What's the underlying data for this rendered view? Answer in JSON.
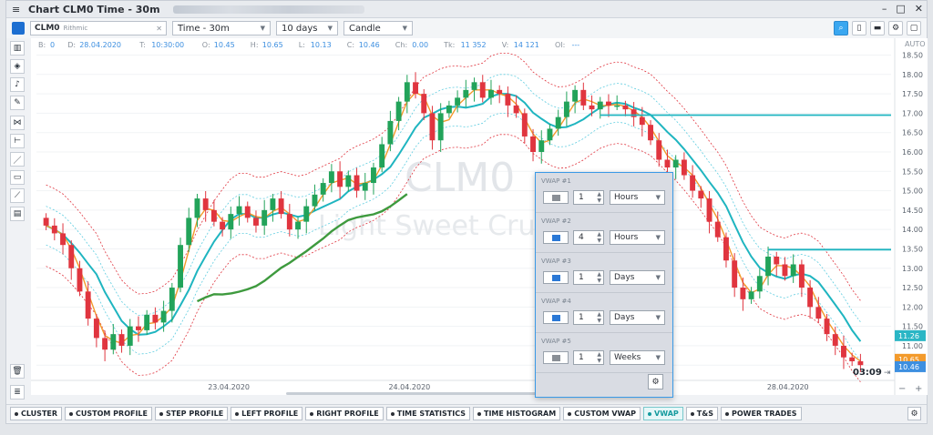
{
  "window": {
    "title": "Chart CLM0 Time - 30m"
  },
  "toolbar": {
    "symbol": "CLM0",
    "symbol_source": "Rithmic",
    "timeframe": "Time - 30m",
    "range": "10 days",
    "chart_type": "Candle"
  },
  "infobar": {
    "items": [
      {
        "k": "B:",
        "v": "0"
      },
      {
        "k": "D:",
        "v": "28.04.2020"
      },
      {
        "k": "T:",
        "v": "10:30:00"
      },
      {
        "k": "O:",
        "v": "10.45"
      },
      {
        "k": "H:",
        "v": "10.65"
      },
      {
        "k": "L:",
        "v": "10.13"
      },
      {
        "k": "C:",
        "v": "10.46"
      },
      {
        "k": "Ch:",
        "v": "0.00"
      },
      {
        "k": "Tk:",
        "v": "11 352"
      },
      {
        "k": "V:",
        "v": "14 121"
      },
      {
        "k": "OI:",
        "v": "---"
      }
    ]
  },
  "watermark": {
    "symbol": "CLM0",
    "name": "Light Sweet Cru"
  },
  "price_axis": {
    "auto_label": "AUTO",
    "ticks": [
      "18.50",
      "18.00",
      "17.50",
      "17.00",
      "16.50",
      "16.00",
      "15.50",
      "15.00",
      "14.50",
      "14.00",
      "13.50",
      "13.00",
      "12.50",
      "12.00",
      "11.50",
      "11.00",
      "10.50"
    ],
    "tags": [
      {
        "label": "11.26",
        "price": 11.26,
        "color": "#2bb6c5"
      },
      {
        "label": "10.65",
        "price": 10.65,
        "color": "#f39a2b"
      },
      {
        "label": "10.46",
        "price": 10.46,
        "color": "#3d8fe0"
      }
    ]
  },
  "time_axis": {
    "labels": [
      {
        "text": "23.04.2020",
        "pos": 0.23
      },
      {
        "text": "24.04.2020",
        "pos": 0.44
      },
      {
        "text": "28.04.2020",
        "pos": 0.88
      }
    ],
    "countdown": "03:09"
  },
  "vwap_popup": {
    "rows": [
      {
        "label": "VWAP #1",
        "color": "#8a8f96",
        "period": "1",
        "unit": "Hours"
      },
      {
        "label": "VWAP #2",
        "color": "#2a78d6",
        "period": "4",
        "unit": "Hours"
      },
      {
        "label": "VWAP #3",
        "color": "#2a78d6",
        "period": "1",
        "unit": "Days"
      },
      {
        "label": "VWAP #4",
        "color": "#2a78d6",
        "period": "1",
        "unit": "Days"
      },
      {
        "label": "VWAP #5",
        "color": "#8a8f96",
        "period": "1",
        "unit": "Weeks"
      }
    ]
  },
  "bottom_tabs": [
    {
      "label": "CLUSTER",
      "active": false
    },
    {
      "label": "CUSTOM PROFILE",
      "active": false
    },
    {
      "label": "STEP PROFILE",
      "active": false
    },
    {
      "label": "LEFT PROFILE",
      "active": false
    },
    {
      "label": "RIGHT PROFILE",
      "active": false
    },
    {
      "label": "TIME STATISTICS",
      "active": false
    },
    {
      "label": "TIME HISTOGRAM",
      "active": false
    },
    {
      "label": "CUSTOM VWAP",
      "active": false
    },
    {
      "label": "VWAP",
      "active": true
    },
    {
      "label": "T&S",
      "active": false
    },
    {
      "label": "POWER TRADES",
      "active": false
    }
  ],
  "colors": {
    "up": "#22a35a",
    "down": "#e0353f",
    "vwap_main": "#1fb5c0",
    "vwap_band": "#5fcde0",
    "band_red": "#e0353f",
    "orange": "#f39a2b",
    "green_line": "#3e9a3e"
  },
  "chart_data": {
    "type": "candlestick",
    "ylim": [
      10.2,
      18.7
    ],
    "y_axis_ticks": [
      18.5,
      18.0,
      17.5,
      17.0,
      16.5,
      16.0,
      15.5,
      15.0,
      14.5,
      14.0,
      13.5,
      13.0,
      12.5,
      12.0,
      11.5,
      11.0,
      10.5
    ],
    "close_path": [
      14.1,
      13.9,
      13.6,
      13.0,
      12.4,
      11.7,
      11.2,
      10.9,
      11.3,
      11.0,
      11.5,
      11.4,
      11.8,
      11.6,
      11.9,
      12.5,
      13.6,
      14.3,
      14.8,
      14.5,
      14.2,
      14.0,
      14.4,
      14.6,
      14.3,
      14.1,
      14.5,
      14.8,
      14.4,
      14.0,
      14.2,
      14.6,
      14.9,
      15.2,
      15.5,
      15.1,
      15.4,
      15.0,
      15.2,
      15.6,
      16.2,
      16.8,
      17.3,
      17.8,
      17.5,
      17.0,
      16.3,
      17.0,
      17.2,
      17.4,
      17.6,
      17.8,
      17.4,
      17.6,
      17.5,
      17.2,
      17.0,
      16.4,
      16.0,
      16.3,
      16.6,
      16.9,
      17.3,
      17.6,
      17.2,
      17.1,
      17.3,
      17.2,
      17.2,
      17.1,
      16.9,
      16.7,
      16.3,
      15.8,
      15.6,
      15.8,
      15.4,
      15.0,
      14.8,
      14.2,
      13.8,
      13.2,
      12.5,
      12.2,
      12.4,
      12.8,
      13.3,
      13.1,
      12.8,
      13.1,
      12.5,
      12.0,
      11.7,
      11.3,
      11.0,
      10.7,
      10.6,
      10.5
    ],
    "horizontal_vwap_levels": [
      {
        "price": 16.95,
        "color": "#1fb5c0"
      },
      {
        "price": 13.48,
        "color": "#1fb5c0"
      }
    ]
  }
}
